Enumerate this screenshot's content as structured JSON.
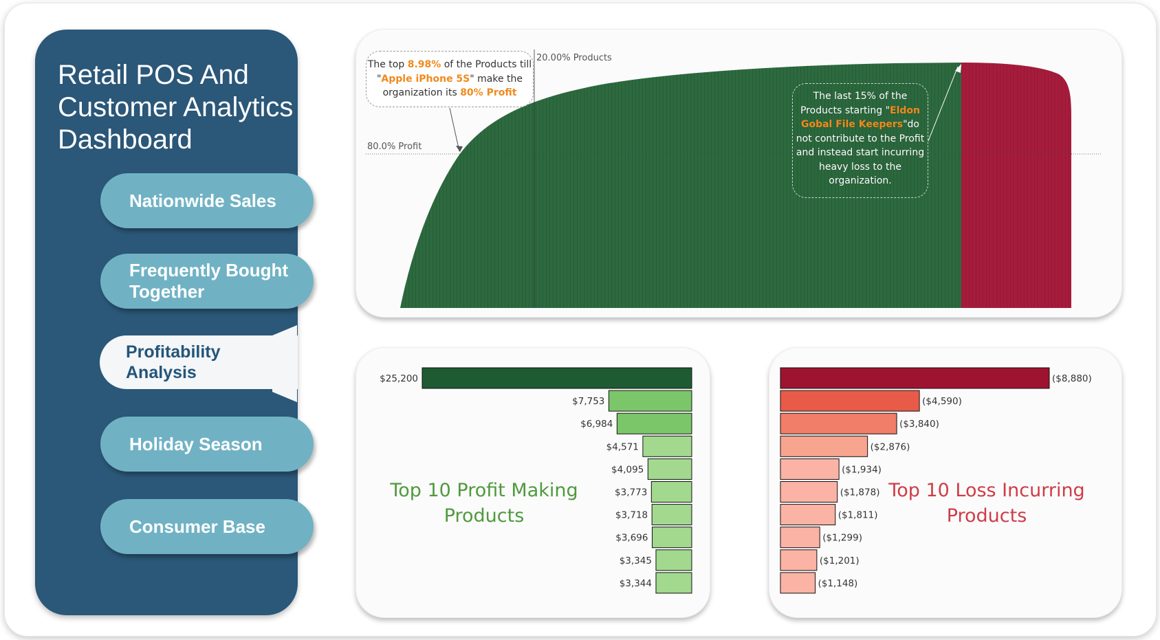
{
  "dashboard": {
    "title": "Retail POS And Customer Analytics Dashboard"
  },
  "nav": {
    "items": [
      {
        "label": "Nationwide Sales"
      },
      {
        "label": "Frequently Bought Together"
      },
      {
        "label": "Profitability Analysis",
        "active": true
      },
      {
        "label": "Holiday Season"
      },
      {
        "label": "Consumer Base"
      }
    ]
  },
  "pareto": {
    "ref_products_label": "20.00% Products",
    "ref_profit_label": "80.0% Profit",
    "callout_1": {
      "text_a": "The top ",
      "pct": "8.98%",
      "text_b": " of the Products till",
      "quote_open": "\"",
      "product": "Apple iPhone 5S",
      "text_c": "\" make the",
      "text_d": "organization its ",
      "profit": "80% Profit"
    },
    "callout_2": {
      "text_a": "The last 15% of the",
      "text_b": "Products starting \"",
      "product": "Eldon Gobal File Keepers",
      "text_c": "\"do not contribute to the Profit and instead start incurring heavy loss to the organization."
    },
    "colors": {
      "profit": "#2d6a3f",
      "loss": "#a61c3c"
    }
  },
  "top_profit": {
    "title": "Top 10 Profit Making Products",
    "labels": [
      "$25,200",
      "$7,753",
      "$6,984",
      "$4,571",
      "$4,095",
      "$3,773",
      "$3,718",
      "$3,696",
      "$3,345",
      "$3,344"
    ]
  },
  "top_loss": {
    "title": "Top 10 Loss Incurring Products",
    "labels": [
      "($8,880)",
      "($4,590)",
      "($3,840)",
      "($2,876)",
      "($1,934)",
      "($1,878)",
      "($1,811)",
      "($1,299)",
      "($1,201)",
      "($1,148)"
    ]
  },
  "chart_data": [
    {
      "type": "area",
      "description_x": "cumulative share of products",
      "x": [
        0,
        0.05,
        0.0898,
        0.2,
        0.4,
        0.6,
        0.8,
        0.85,
        0.9,
        1.0
      ],
      "y": [
        0,
        0.62,
        0.8,
        0.93,
        1.05,
        1.12,
        1.16,
        1.165,
        1.16,
        1.0
      ],
      "reference_lines": {
        "x": 0.2,
        "y": 0.8
      },
      "grid": false
    },
    {
      "type": "bar",
      "orientation": "horizontal",
      "values": [
        25200,
        7753,
        6984,
        4571,
        4095,
        3773,
        3718,
        3696,
        3345,
        3344
      ],
      "series": [
        {
          "name": "Top 10 Profit Making Products",
          "values": [
            25200,
            7753,
            6984,
            4571,
            4095,
            3773,
            3718,
            3696,
            3345,
            3344
          ]
        }
      ],
      "colors": [
        "#1e5b32",
        "#7cc66a"
      ]
    },
    {
      "type": "bar",
      "orientation": "horizontal",
      "values": [
        -8880,
        -4590,
        -3840,
        -2876,
        -1934,
        -1878,
        -1811,
        -1299,
        -1201,
        -1148
      ],
      "series": [
        {
          "name": "Top 10 Loss Incurring Products",
          "values": [
            -8880,
            -4590,
            -3840,
            -2876,
            -1934,
            -1878,
            -1811,
            -1299,
            -1201,
            -1148
          ]
        }
      ],
      "colors": [
        "#9e1330",
        "#e85b48",
        "#f07e68",
        "#f7a58f",
        "#fbb3a5"
      ]
    }
  ]
}
